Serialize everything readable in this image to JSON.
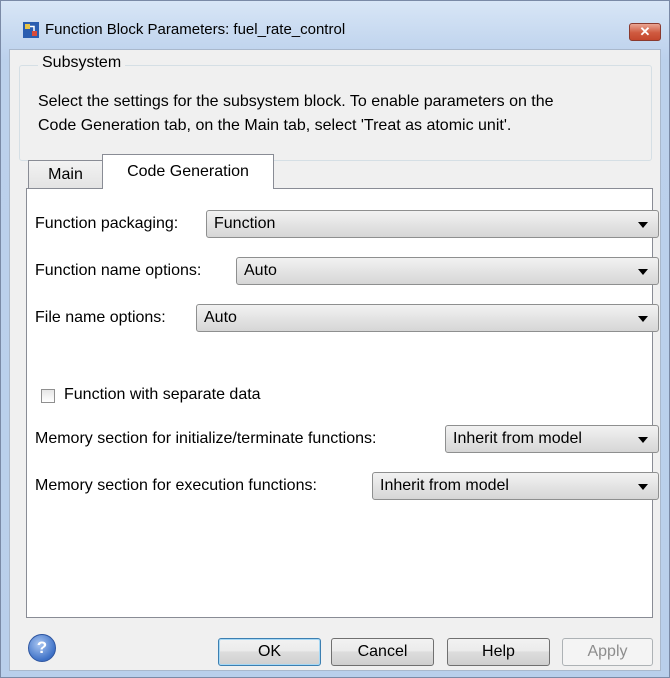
{
  "window": {
    "title": "Function Block Parameters: fuel_rate_control",
    "close_glyph": "✕",
    "icon": "simulink-block-icon"
  },
  "group": {
    "legend": "Subsystem",
    "description_line1": "Select the settings for the subsystem block. To enable parameters on the",
    "description_line2": "Code Generation tab, on the Main tab, select 'Treat as atomic unit'."
  },
  "tabs": [
    {
      "label": "Main",
      "active": false
    },
    {
      "label": "Code Generation",
      "active": true
    }
  ],
  "fields": {
    "function_packaging": {
      "label": "Function packaging:",
      "value": "Function"
    },
    "function_name_options": {
      "label": "Function name options:",
      "value": "Auto"
    },
    "file_name_options": {
      "label": "File name options:",
      "value": "Auto"
    },
    "separate_data": {
      "label": "Function with separate data",
      "checked": false
    },
    "memory_init_term": {
      "label": "Memory section for initialize/terminate functions:",
      "value": "Inherit from model"
    },
    "memory_exec": {
      "label": "Memory section for execution functions:",
      "value": "Inherit from model"
    }
  },
  "buttons": {
    "help_icon_glyph": "?",
    "ok": "OK",
    "cancel": "Cancel",
    "help": "Help",
    "apply": "Apply"
  }
}
